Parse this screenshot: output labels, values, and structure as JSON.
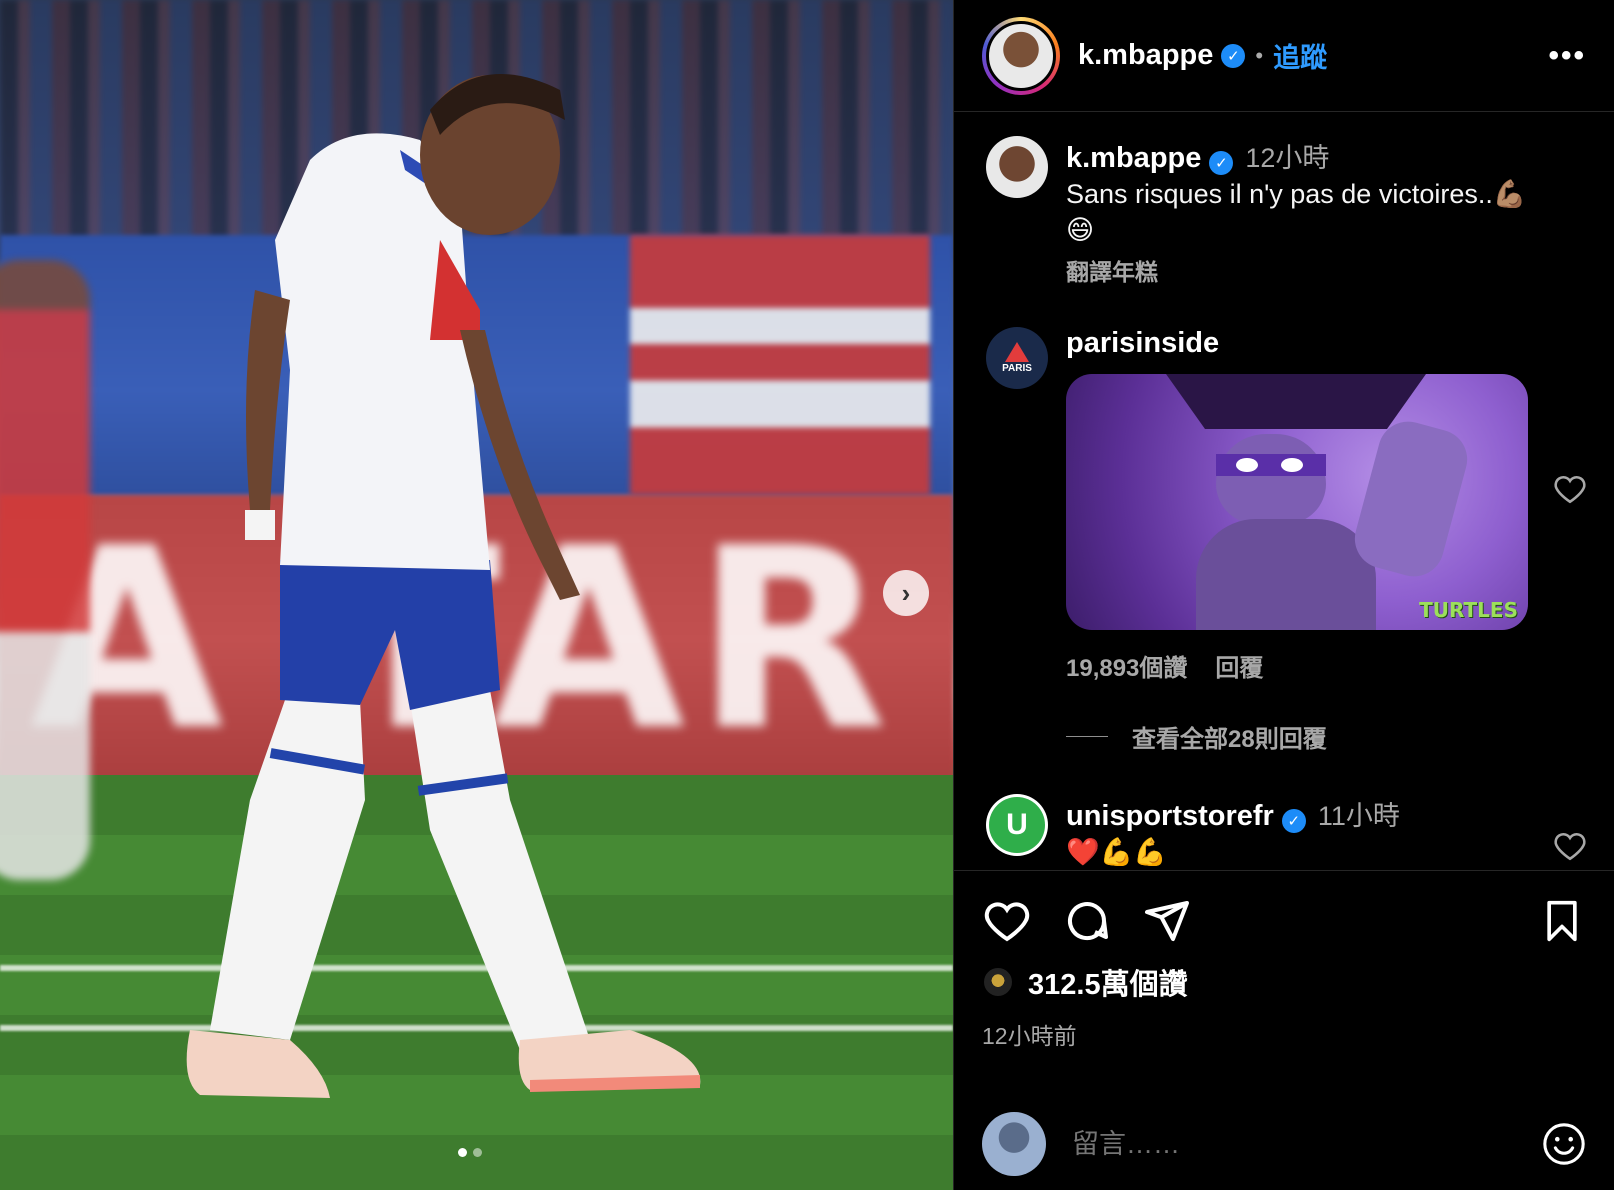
{
  "post": {
    "author": "k.mbappe",
    "follow_label": "追蹤",
    "separator": "•",
    "more_label": "•••"
  },
  "media": {
    "next_label": "›",
    "slide_count": 2,
    "current_slide": 1
  },
  "caption": {
    "user": "k.mbappe",
    "time": "12小時",
    "text": "Sans risques il n'y pas de victoires..💪🏽",
    "text_line2": "😄",
    "translate": "翻譯年糕"
  },
  "comments": [
    {
      "user": "parisinside",
      "time": "",
      "gif_logo": "TURTLES",
      "likes": "19,893個讚",
      "reply_label": "回覆",
      "view_replies": "查看全部28則回覆"
    },
    {
      "user": "unisportstorefr",
      "time": "11小時",
      "text": "❤️💪💪"
    }
  ],
  "footer": {
    "likes": "312.5萬個讚",
    "posted": "12小時前",
    "comment_placeholder": "留言……"
  },
  "colors": {
    "accent": "#2f9bff",
    "verified": "#1d8cf8",
    "muted": "#a8a8a8"
  }
}
